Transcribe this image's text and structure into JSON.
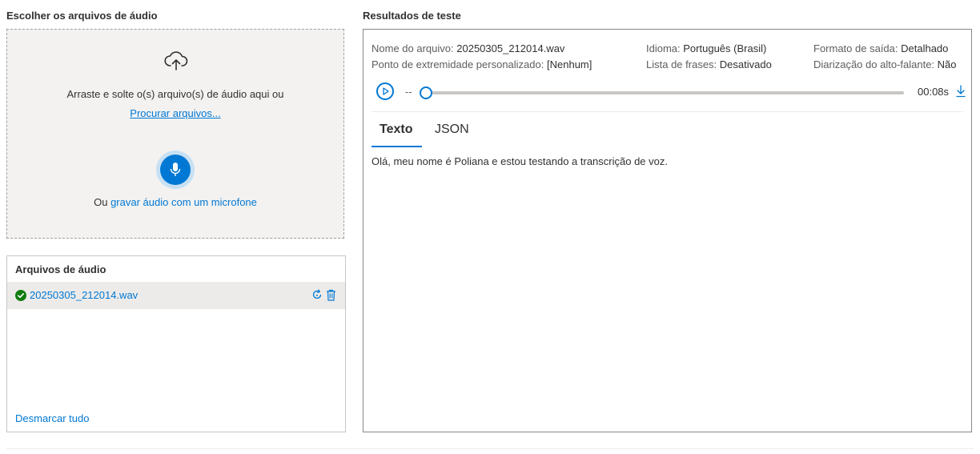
{
  "left": {
    "title": "Escolher os arquivos de áudio",
    "drop_text": "Arraste e solte o(s) arquivo(s) de áudio aqui ou",
    "browse_link": "Procurar arquivos...",
    "record_prefix": "Ou",
    "record_link": "gravar áudio com um microfone",
    "icons": [
      "cloud-upload-icon",
      "microphone-icon"
    ]
  },
  "files": {
    "title": "Arquivos de áudio",
    "items": [
      {
        "name": "20250305_212014.wav",
        "status": "success"
      }
    ],
    "unselect_label": "Desmarcar tudo"
  },
  "results": {
    "title": "Resultados de teste",
    "meta": {
      "file_label": "Nome do arquivo:",
      "file_value": "20250305_212014.wav",
      "endpoint_label": "Ponto de extremidade personalizado:",
      "endpoint_value": "[Nenhum]",
      "language_label": "Idioma:",
      "language_value": "Português (Brasil)",
      "phrase_label": "Lista de frases:",
      "phrase_value": "Desativado",
      "format_label": "Formato de saída:",
      "format_value": "Detalhado",
      "diarization_label": "Diarização do alto-falante:",
      "diarization_value": "Não"
    },
    "player": {
      "current_time": "--",
      "duration": "00:08s",
      "progress": 0
    },
    "tabs": [
      {
        "label": "Texto",
        "active": true
      },
      {
        "label": "JSON",
        "active": false
      }
    ],
    "transcript": "Olá, meu nome é Poliana e estou testando a transcrição de voz."
  },
  "colors": {
    "accent": "#0078d4",
    "success": "#107c10",
    "dropzone_bg": "#f3f2f1"
  }
}
